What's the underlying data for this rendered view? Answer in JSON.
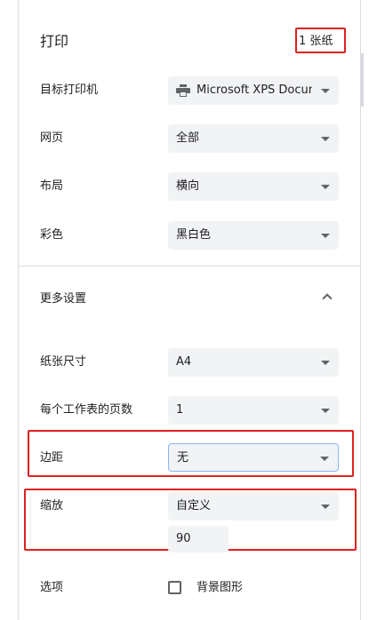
{
  "header": {
    "title": "打印",
    "sheet_count": "1 张纸"
  },
  "destination": {
    "label": "目标打印机",
    "value": "Microsoft XPS Docum",
    "icon": "printer-icon"
  },
  "pages": {
    "label": "网页",
    "value": "全部"
  },
  "layout": {
    "label": "布局",
    "value": "横向"
  },
  "color": {
    "label": "彩色",
    "value": "黑白色"
  },
  "more_settings": {
    "label": "更多设置",
    "icon": "chevron-up-icon"
  },
  "paper_size": {
    "label": "纸张尺寸",
    "value": "A4"
  },
  "pages_per_sheet": {
    "label": "每个工作表的页数",
    "value": "1"
  },
  "margins": {
    "label": "边距",
    "value": "无"
  },
  "scale": {
    "label": "缩放",
    "value": "自定义",
    "custom_value": "90"
  },
  "options": {
    "label": "选项",
    "checkbox_label": "背景图形",
    "checked": false
  },
  "colors": {
    "highlight": "#e02020",
    "select_bg": "#f1f3f4",
    "focus_border": "#8ab4f8",
    "divider": "#dadce0"
  }
}
